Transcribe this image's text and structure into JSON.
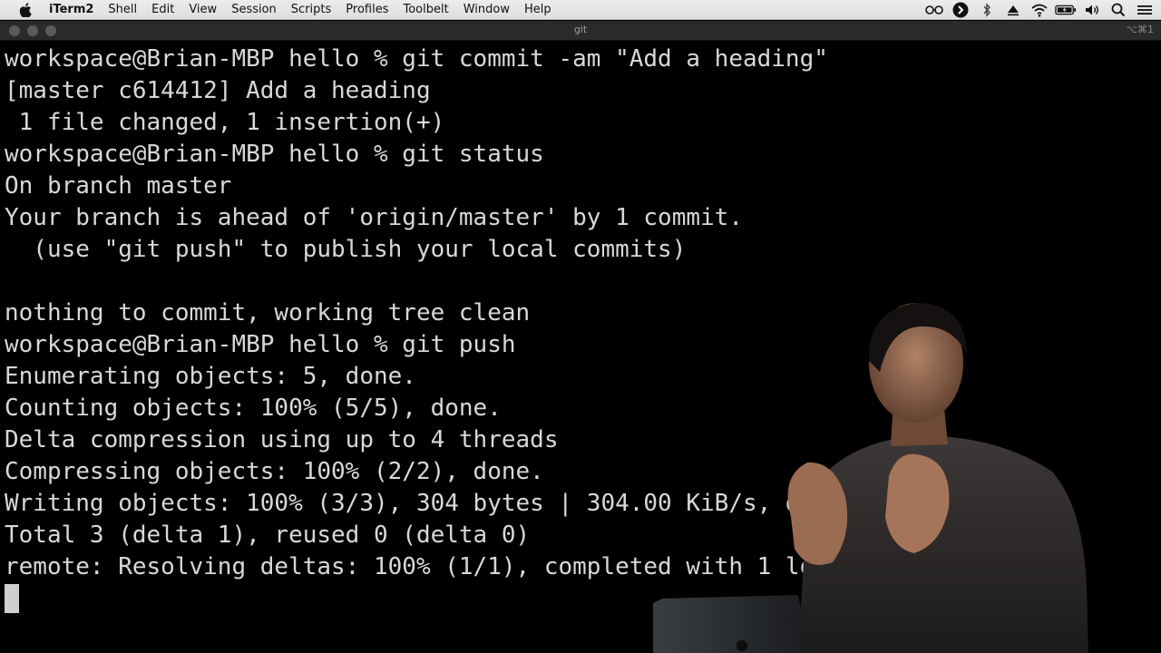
{
  "menubar": {
    "app_name": "iTerm2",
    "items": [
      "Shell",
      "Edit",
      "View",
      "Session",
      "Scripts",
      "Profiles",
      "Toolbelt",
      "Window",
      "Help"
    ],
    "status_icons": [
      "glasses-icon",
      "circle-arrow-icon",
      "bluetooth-icon",
      "airplay-icon",
      "wifi-icon",
      "battery-icon",
      "volume-icon",
      "search-icon",
      "menu-icon"
    ]
  },
  "window": {
    "title": "git",
    "shortcut": "⌥⌘1"
  },
  "terminal": {
    "lines": [
      "workspace@Brian-MBP hello % git commit -am \"Add a heading\"",
      "[master c614412] Add a heading",
      " 1 file changed, 1 insertion(+)",
      "workspace@Brian-MBP hello % git status",
      "On branch master",
      "Your branch is ahead of 'origin/master' by 1 commit.",
      "  (use \"git push\" to publish your local commits)",
      "",
      "nothing to commit, working tree clean",
      "workspace@Brian-MBP hello % git push",
      "Enumerating objects: 5, done.",
      "Counting objects: 100% (5/5), done.",
      "Delta compression using up to 4 threads",
      "Compressing objects: 100% (2/2), done.",
      "Writing objects: 100% (3/3), 304 bytes | 304.00 KiB/s, done.",
      "Total 3 (delta 1), reused 0 (delta 0)",
      "remote: Resolving deltas: 100% (1/1), completed with 1 local object."
    ]
  },
  "colors": {
    "terminal_bg": "#000000",
    "terminal_fg": "#d8d8d8",
    "menubar_bg": "#e8e8e8"
  }
}
